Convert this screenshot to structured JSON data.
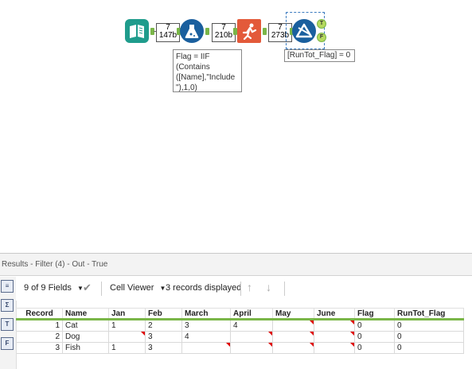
{
  "workflow": {
    "conn1": {
      "records": "7",
      "size": "147b"
    },
    "conn2": {
      "records": "7",
      "size": "210b"
    },
    "conn3": {
      "records": "7",
      "size": "273b"
    },
    "formula_annotation": "Flag = IIF\n(Contains\n([Name],\"Include\n\"),1,0)",
    "filter_annotation": "[RunTot_Flag] = 0",
    "filter_true_label": "T",
    "filter_false_label": "F",
    "colors": {
      "input": "#1f9c8c",
      "formula": "#1a5f9e",
      "running_total": "#e35a3a",
      "filter": "#1a5f9e",
      "anchor": "#7ab648"
    }
  },
  "results": {
    "title": "Results - Filter (4) - Out - True",
    "toolbar": {
      "fields": "9 of 9 Fields",
      "viewer": "Cell Viewer",
      "records": "3 records displayed"
    },
    "side_icons": [
      "T",
      "F"
    ],
    "columns": [
      "Record",
      "Name",
      "Jan",
      "Feb",
      "March",
      "April",
      "May",
      "June",
      "Flag",
      "RunTot_Flag"
    ],
    "rows": [
      [
        "1",
        "Cat",
        "1",
        "2",
        "3",
        "4",
        "",
        "",
        "0",
        "0"
      ],
      [
        "2",
        "Dog",
        "",
        "3",
        "4",
        "",
        "",
        "",
        "0",
        "0"
      ],
      [
        "3",
        "Fish",
        "1",
        "3",
        "",
        "",
        "",
        "",
        "0",
        "0"
      ]
    ]
  }
}
